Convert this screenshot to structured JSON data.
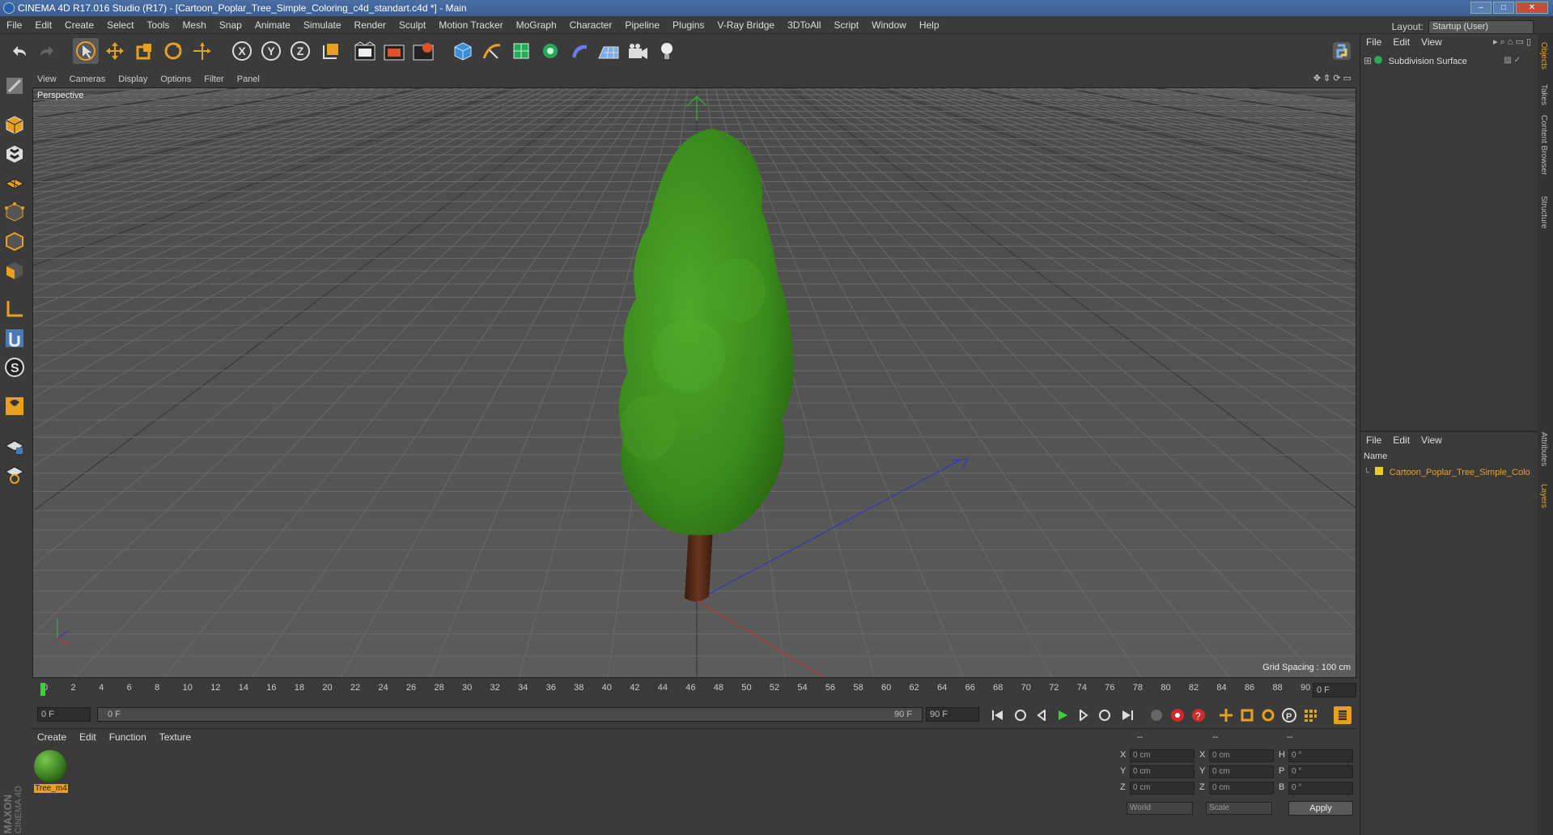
{
  "window": {
    "title": "CINEMA 4D R17.016 Studio (R17) - [Cartoon_Poplar_Tree_Simple_Coloring_c4d_standart.c4d *] - Main"
  },
  "menubar": {
    "items": [
      "File",
      "Edit",
      "Create",
      "Select",
      "Tools",
      "Mesh",
      "Snap",
      "Animate",
      "Simulate",
      "Render",
      "Sculpt",
      "Motion Tracker",
      "MoGraph",
      "Character",
      "Pipeline",
      "Plugins",
      "V-Ray Bridge",
      "3DToAll",
      "Script",
      "Window",
      "Help"
    ],
    "layout_label": "Layout:",
    "layout_value": "Startup (User)"
  },
  "toolbar": {
    "axis_x": "X",
    "axis_y": "Y",
    "axis_z": "Z"
  },
  "viewport": {
    "menu": [
      "View",
      "Cameras",
      "Display",
      "Options",
      "Filter",
      "Panel"
    ],
    "camera_label": "Perspective",
    "grid_spacing": "Grid Spacing : 100 cm"
  },
  "timeline": {
    "ticks": [
      "0",
      "2",
      "4",
      "6",
      "8",
      "10",
      "12",
      "14",
      "16",
      "18",
      "20",
      "22",
      "24",
      "26",
      "28",
      "30",
      "32",
      "34",
      "36",
      "38",
      "40",
      "42",
      "44",
      "46",
      "48",
      "50",
      "52",
      "54",
      "56",
      "58",
      "60",
      "62",
      "64",
      "66",
      "68",
      "70",
      "72",
      "74",
      "76",
      "78",
      "80",
      "82",
      "84",
      "86",
      "88",
      "90"
    ],
    "current_frame": "0 F",
    "start_field": "0 F",
    "range_start": "0 F",
    "range_end": "90 F",
    "end_field": "90 F"
  },
  "material_manager": {
    "menu": [
      "Create",
      "Edit",
      "Function",
      "Texture"
    ],
    "material_name": "Tree_m4"
  },
  "coordinates": {
    "header": [
      "--",
      "--",
      "--"
    ],
    "rows": [
      {
        "l1": "X",
        "v1": "0 cm",
        "l2": "X",
        "v2": "0 cm",
        "l3": "H",
        "v3": "0 °"
      },
      {
        "l1": "Y",
        "v1": "0 cm",
        "l2": "Y",
        "v2": "0 cm",
        "l3": "P",
        "v3": "0 °"
      },
      {
        "l1": "Z",
        "v1": "0 cm",
        "l2": "Z",
        "v2": "0 cm",
        "l3": "B",
        "v3": "0 °"
      }
    ],
    "world": "World",
    "scale": "Scale",
    "apply": "Apply"
  },
  "object_manager": {
    "menu": [
      "File",
      "Edit",
      "View"
    ],
    "object_name": "Subdivision Surface"
  },
  "layer_manager": {
    "menu": [
      "File",
      "Edit",
      "View"
    ],
    "name_header": "Name",
    "layer_name": "Cartoon_Poplar_Tree_Simple_Colo"
  },
  "right_tabs": {
    "objects": "Objects",
    "takes": "Takes",
    "content_browser": "Content Browser",
    "structure": "Structure",
    "attributes": "Attributes",
    "layers": "Layers"
  },
  "branding": {
    "maxon": "MAXON",
    "cinema": "CINEMA 4D"
  },
  "colors": {
    "accent": "#f0a020",
    "tree_green": "#3f8f1c",
    "trunk": "#5a2e1a",
    "play_green": "#3ad13a"
  }
}
